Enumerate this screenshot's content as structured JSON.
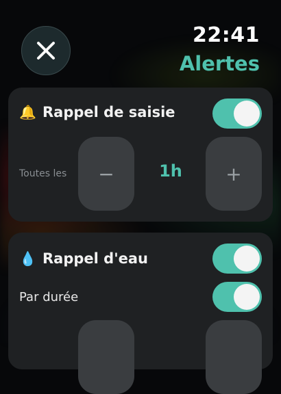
{
  "header": {
    "time": "22:41",
    "title": "Alertes"
  },
  "colors": {
    "accent": "#4fc1ad",
    "card": "#1f2123",
    "button": "#3a3d40"
  },
  "sections": [
    {
      "icon": "bell-icon",
      "emoji": "🔔",
      "title": "Rappel de saisie",
      "enabled": true,
      "stepper": {
        "label": "Toutes les",
        "value": "1h",
        "decrement": "−",
        "increment": "+"
      }
    },
    {
      "icon": "droplet-icon",
      "emoji": "💧",
      "title": "Rappel d'eau",
      "enabled": true,
      "options": [
        {
          "label": "Par durée",
          "enabled": true
        }
      ]
    }
  ]
}
